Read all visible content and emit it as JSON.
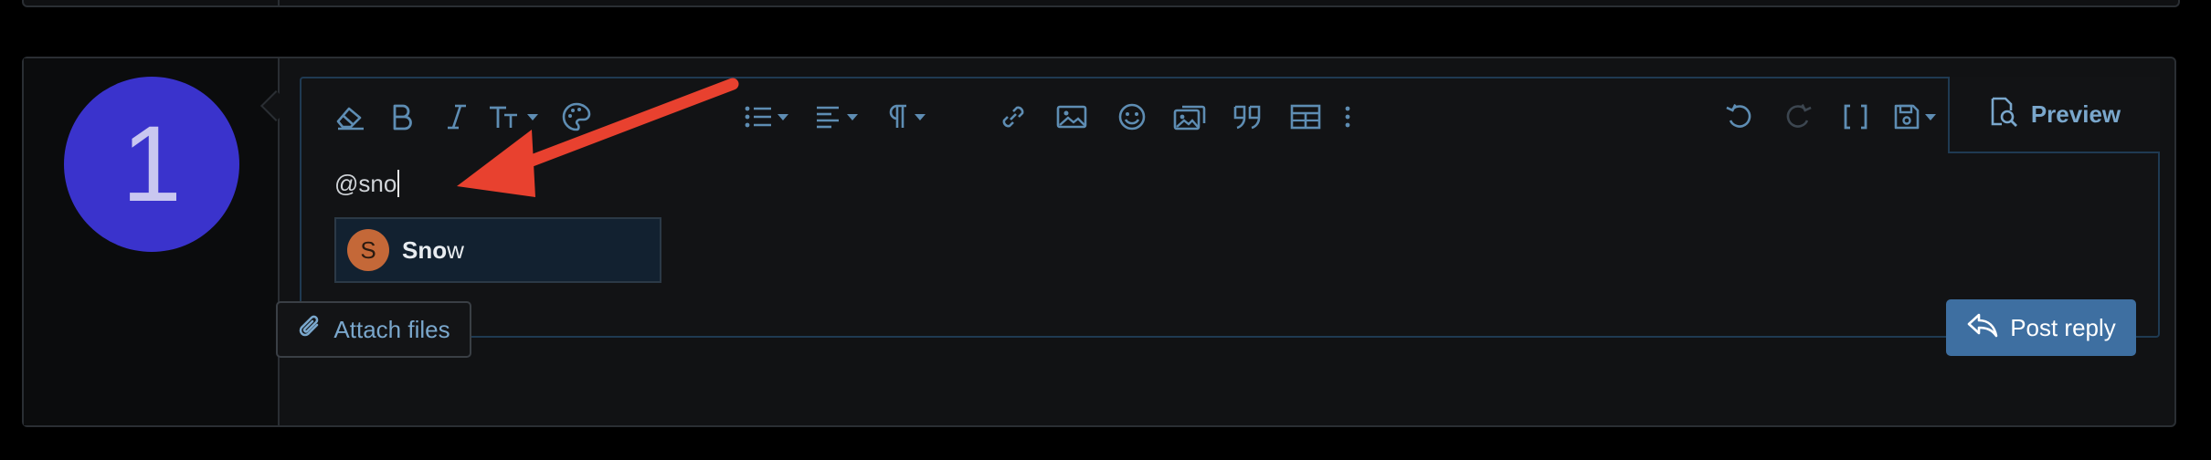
{
  "composer": {
    "avatar_letter": "1",
    "typed_text": "@sno",
    "preview_label": "Preview",
    "attach_label": "Attach files",
    "post_label": "Post reply"
  },
  "mention_suggestion": {
    "avatar_letter": "S",
    "name_match": "Sno",
    "name_rest": "w"
  },
  "toolbar_icons": [
    "eraser-icon",
    "bold-icon",
    "italic-icon",
    "text-size-icon",
    "palette-icon",
    "list-icon",
    "align-icon",
    "paragraph-icon",
    "link-icon",
    "image-icon",
    "smiley-icon",
    "media-icon",
    "quote-icon",
    "table-icon",
    "more-icon",
    "undo-icon",
    "redo-icon",
    "bbcode-icon",
    "save-draft-icon"
  ],
  "colors": {
    "accent": "#5e8db3",
    "post_button": "#3e6fa1",
    "avatar": "#3a33cc",
    "mention_avatar": "#c46838",
    "annotation_arrow": "#e8412f"
  }
}
